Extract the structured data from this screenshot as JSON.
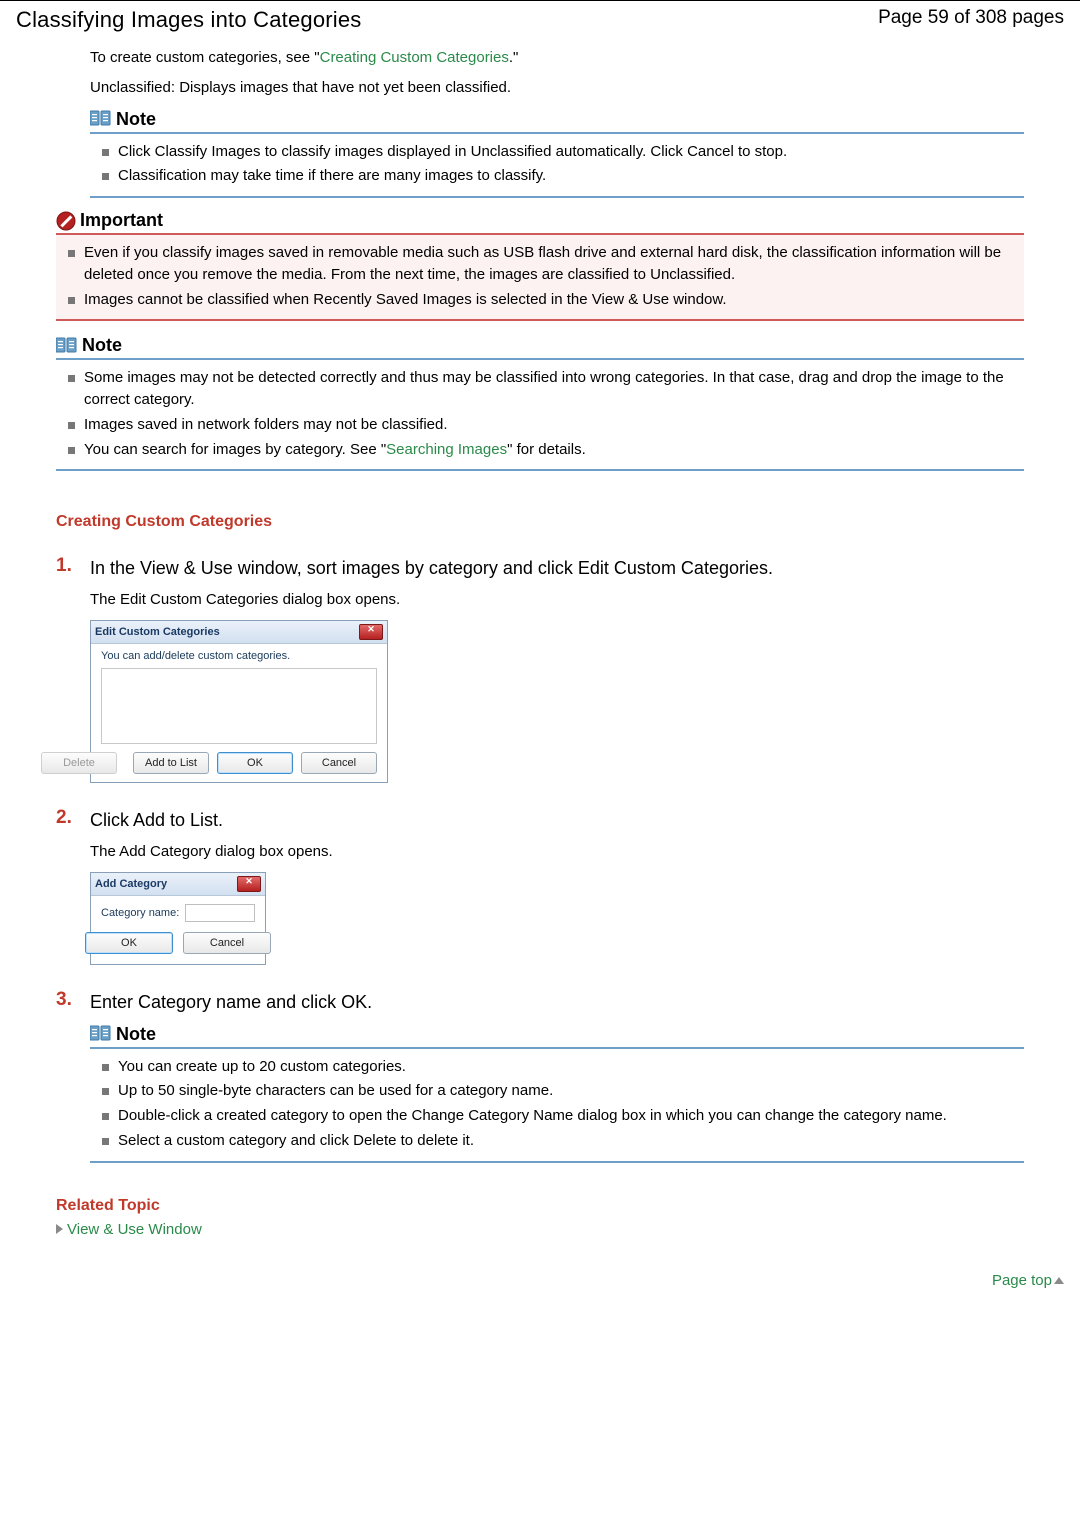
{
  "header": {
    "title": "Classifying Images into Categories",
    "page_indicator": "Page 59 of 308 pages"
  },
  "intro": {
    "pre": "To create custom categories, see \"",
    "link": "Creating Custom Categories",
    "post": ".\"",
    "unclassified": "Unclassified: Displays images that have not yet been classified."
  },
  "note1": {
    "label": "Note",
    "items": [
      "Click Classify Images to classify images displayed in Unclassified automatically. Click Cancel to stop.",
      "Classification may take time if there are many images to classify."
    ]
  },
  "important": {
    "label": "Important",
    "items": [
      "Even if you classify images saved in removable media such as USB flash drive and external hard disk, the classification information will be deleted once you remove the media. From the next time, the images are classified to Unclassified.",
      "Images cannot be classified when Recently Saved Images is selected in the View & Use window."
    ]
  },
  "note2": {
    "label": "Note",
    "item1": "Some images may not be detected correctly and thus may be classified into wrong categories. In that case, drag and drop the image to the correct category.",
    "item2": "Images saved in network folders may not be classified.",
    "item3_pre": "You can search for images by category. See \"",
    "item3_link": "Searching Images",
    "item3_post": "\" for details."
  },
  "section": {
    "title": "Creating Custom Categories"
  },
  "steps": {
    "s1": {
      "title": "In the View & Use window, sort images by category and click Edit Custom Categories.",
      "sub": "The Edit Custom Categories dialog box opens."
    },
    "s2": {
      "title": "Click Add to List.",
      "sub": "The Add Category dialog box opens."
    },
    "s3": {
      "title": "Enter Category name and click OK."
    }
  },
  "ecc_dialog": {
    "title": "Edit Custom Categories",
    "desc": "You can add/delete custom categories.",
    "buttons": {
      "delete": "Delete",
      "add": "Add to List",
      "ok": "OK",
      "cancel": "Cancel"
    }
  },
  "ac_dialog": {
    "title": "Add Category",
    "label": "Category name:",
    "ok": "OK",
    "cancel": "Cancel"
  },
  "note3": {
    "label": "Note",
    "items": [
      "You can create up to 20 custom categories.",
      "Up to 50 single-byte characters can be used for a category name.",
      "Double-click a created category to open the Change Category Name dialog box in which you can change the category name.",
      "Select a custom category and click Delete to delete it."
    ]
  },
  "related": {
    "title": "Related Topic",
    "link": "View & Use Window"
  },
  "page_top": "Page top"
}
